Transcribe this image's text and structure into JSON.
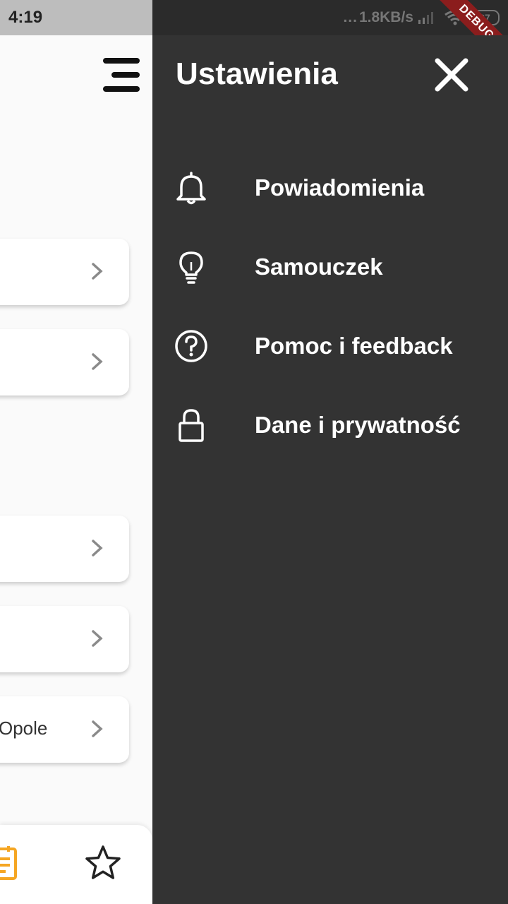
{
  "status_bar": {
    "time": "4:19",
    "signal_dots": "...",
    "network_speed": "1.8KB/s",
    "battery": "37",
    "debug_label": "DEBUG"
  },
  "page": {
    "last_card_text": "Opole"
  },
  "drawer": {
    "title": "Ustawienia",
    "items": [
      {
        "icon": "bell-icon",
        "label": "Powiadomienia"
      },
      {
        "icon": "lightbulb-icon",
        "label": "Samouczek"
      },
      {
        "icon": "help-circle-icon",
        "label": "Pomoc i feedback"
      },
      {
        "icon": "lock-icon",
        "label": "Dane i prywatność"
      }
    ]
  },
  "colors": {
    "drawer_background": "#333333",
    "accent_orange": "#f5a623"
  }
}
